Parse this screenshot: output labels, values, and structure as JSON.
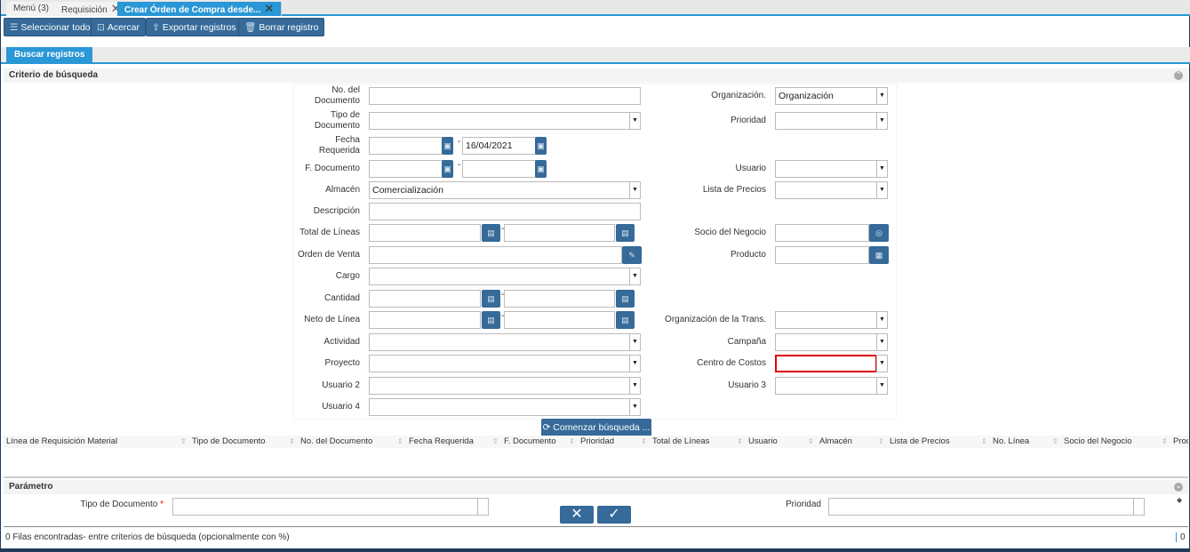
{
  "tabs": [
    {
      "label": "Menú (3)"
    },
    {
      "label": "Requisición",
      "closable": true
    },
    {
      "label": "Crear Órden de Compra desde...",
      "closable": true,
      "active": true
    }
  ],
  "toolbar": {
    "select_all": "Seleccionar todo",
    "zoom": "Acercar",
    "export": "Exportar registros",
    "delete": "Borrar registro"
  },
  "subtab": "Buscar registros",
  "criteria": {
    "title": "Criterio de búsqueda",
    "left": [
      {
        "label": "No. del Documento",
        "type": "text",
        "value": ""
      },
      {
        "label": "Tipo de Documento",
        "type": "select",
        "value": ""
      },
      {
        "label": "Fecha Requerida",
        "type": "date-range",
        "from": "",
        "to": "16/04/2021"
      },
      {
        "label": "F. Documento",
        "type": "date-range",
        "from": "",
        "to": ""
      },
      {
        "label": "Almacén",
        "type": "select",
        "value": "Comercialización"
      },
      {
        "label": "Descripción",
        "type": "text",
        "value": ""
      },
      {
        "label": "Total de Líneas",
        "type": "number-range",
        "from": "",
        "to": ""
      },
      {
        "label": "Orden de Venta",
        "type": "search",
        "value": ""
      },
      {
        "label": "Cargo",
        "type": "select",
        "value": ""
      },
      {
        "label": "Cantidad",
        "type": "number-range",
        "from": "",
        "to": ""
      },
      {
        "label": "Neto de Línea",
        "type": "number-range",
        "from": "",
        "to": ""
      },
      {
        "label": "Actividad",
        "type": "select",
        "value": ""
      },
      {
        "label": "Proyecto",
        "type": "select",
        "value": ""
      },
      {
        "label": "Usuario 2",
        "type": "select",
        "value": ""
      },
      {
        "label": "Usuario 4",
        "type": "select",
        "value": ""
      }
    ],
    "right": [
      {
        "row": 0,
        "label": "Organización.",
        "type": "select",
        "value": "Organización"
      },
      {
        "row": 1,
        "label": "Prioridad",
        "type": "select",
        "value": ""
      },
      {
        "row": 3,
        "label": "Usuario",
        "type": "select",
        "value": ""
      },
      {
        "row": 4,
        "label": "Lista de Precios",
        "type": "select",
        "value": ""
      },
      {
        "row": 6,
        "label": "Socio del Negocio",
        "type": "bpartner",
        "value": ""
      },
      {
        "row": 7,
        "label": "Producto",
        "type": "product",
        "value": ""
      },
      {
        "row": 10,
        "label": "Organización de la Trans.",
        "type": "select",
        "value": ""
      },
      {
        "row": 11,
        "label": "Campaña",
        "type": "select",
        "value": ""
      },
      {
        "row": 12,
        "label": "Centro de Costos",
        "type": "select",
        "value": "",
        "error": true
      },
      {
        "row": 13,
        "label": "Usuario 3",
        "type": "select",
        "value": ""
      }
    ],
    "search_button": "Comenzar búsqueda ..."
  },
  "grid": {
    "columns": [
      "Línea de Requisición Material",
      "Tipo de Documento",
      "No. del Documento",
      "Fecha Requerida",
      "F. Documento",
      "Prioridad",
      "Total de Líneas",
      "Usuario",
      "Almacén",
      "Lista de Precios",
      "No. Línea",
      "Socio del Negocio",
      "Prod"
    ]
  },
  "parameters": {
    "title": "Parámetro",
    "doc_type_label": "Tipo de Documento",
    "priority_label": "Prioridad"
  },
  "status": {
    "message": "0 Filas encontradas- entre criterios de búsqueda (opcionalmente con %)",
    "count": "0"
  },
  "colors": {
    "accent": "#2a97d6",
    "button": "#356a99",
    "error": "#e00000"
  }
}
